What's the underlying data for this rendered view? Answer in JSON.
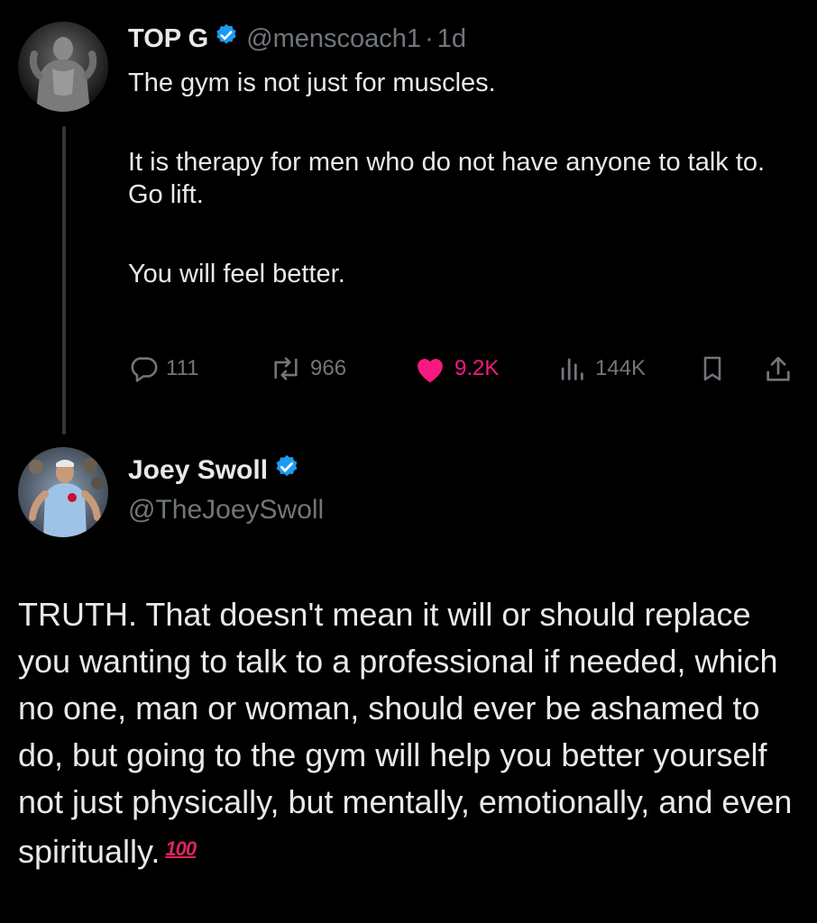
{
  "original_tweet": {
    "author_name": "TOP G",
    "handle": "@menscoach1",
    "separator": "·",
    "time": "1d",
    "lines": [
      "The gym is not just for muscles.",
      "It is therapy for men who do not have anyone to talk to.",
      "Go lift.",
      "You will feel better."
    ],
    "stats": {
      "replies": "111",
      "reposts": "966",
      "likes": "9.2K",
      "views": "144K"
    }
  },
  "reply_tweet": {
    "author_name": "Joey Swoll",
    "handle": "@TheJoeySwoll",
    "text": "TRUTH. That doesn't mean it will or should replace you wanting to talk to a professional if needed, which no one, man or woman, should ever be ashamed to do, but going to the gym will help you better yourself not just physically, but mentally, emotionally, and even spiritually.",
    "emoji": "100",
    "emoji_name": "hundred-points-emoji"
  },
  "icons": {
    "verified": "verified-badge-icon",
    "reply": "reply-icon",
    "repost": "repost-icon",
    "like": "heart-icon",
    "views": "views-icon",
    "bookmark": "bookmark-icon",
    "share": "share-icon"
  },
  "colors": {
    "background": "#000000",
    "text": "#e7e9ea",
    "muted": "#71767b",
    "like": "#f91880",
    "verified": "#1d9bf0",
    "hundred": "#e0245e"
  }
}
